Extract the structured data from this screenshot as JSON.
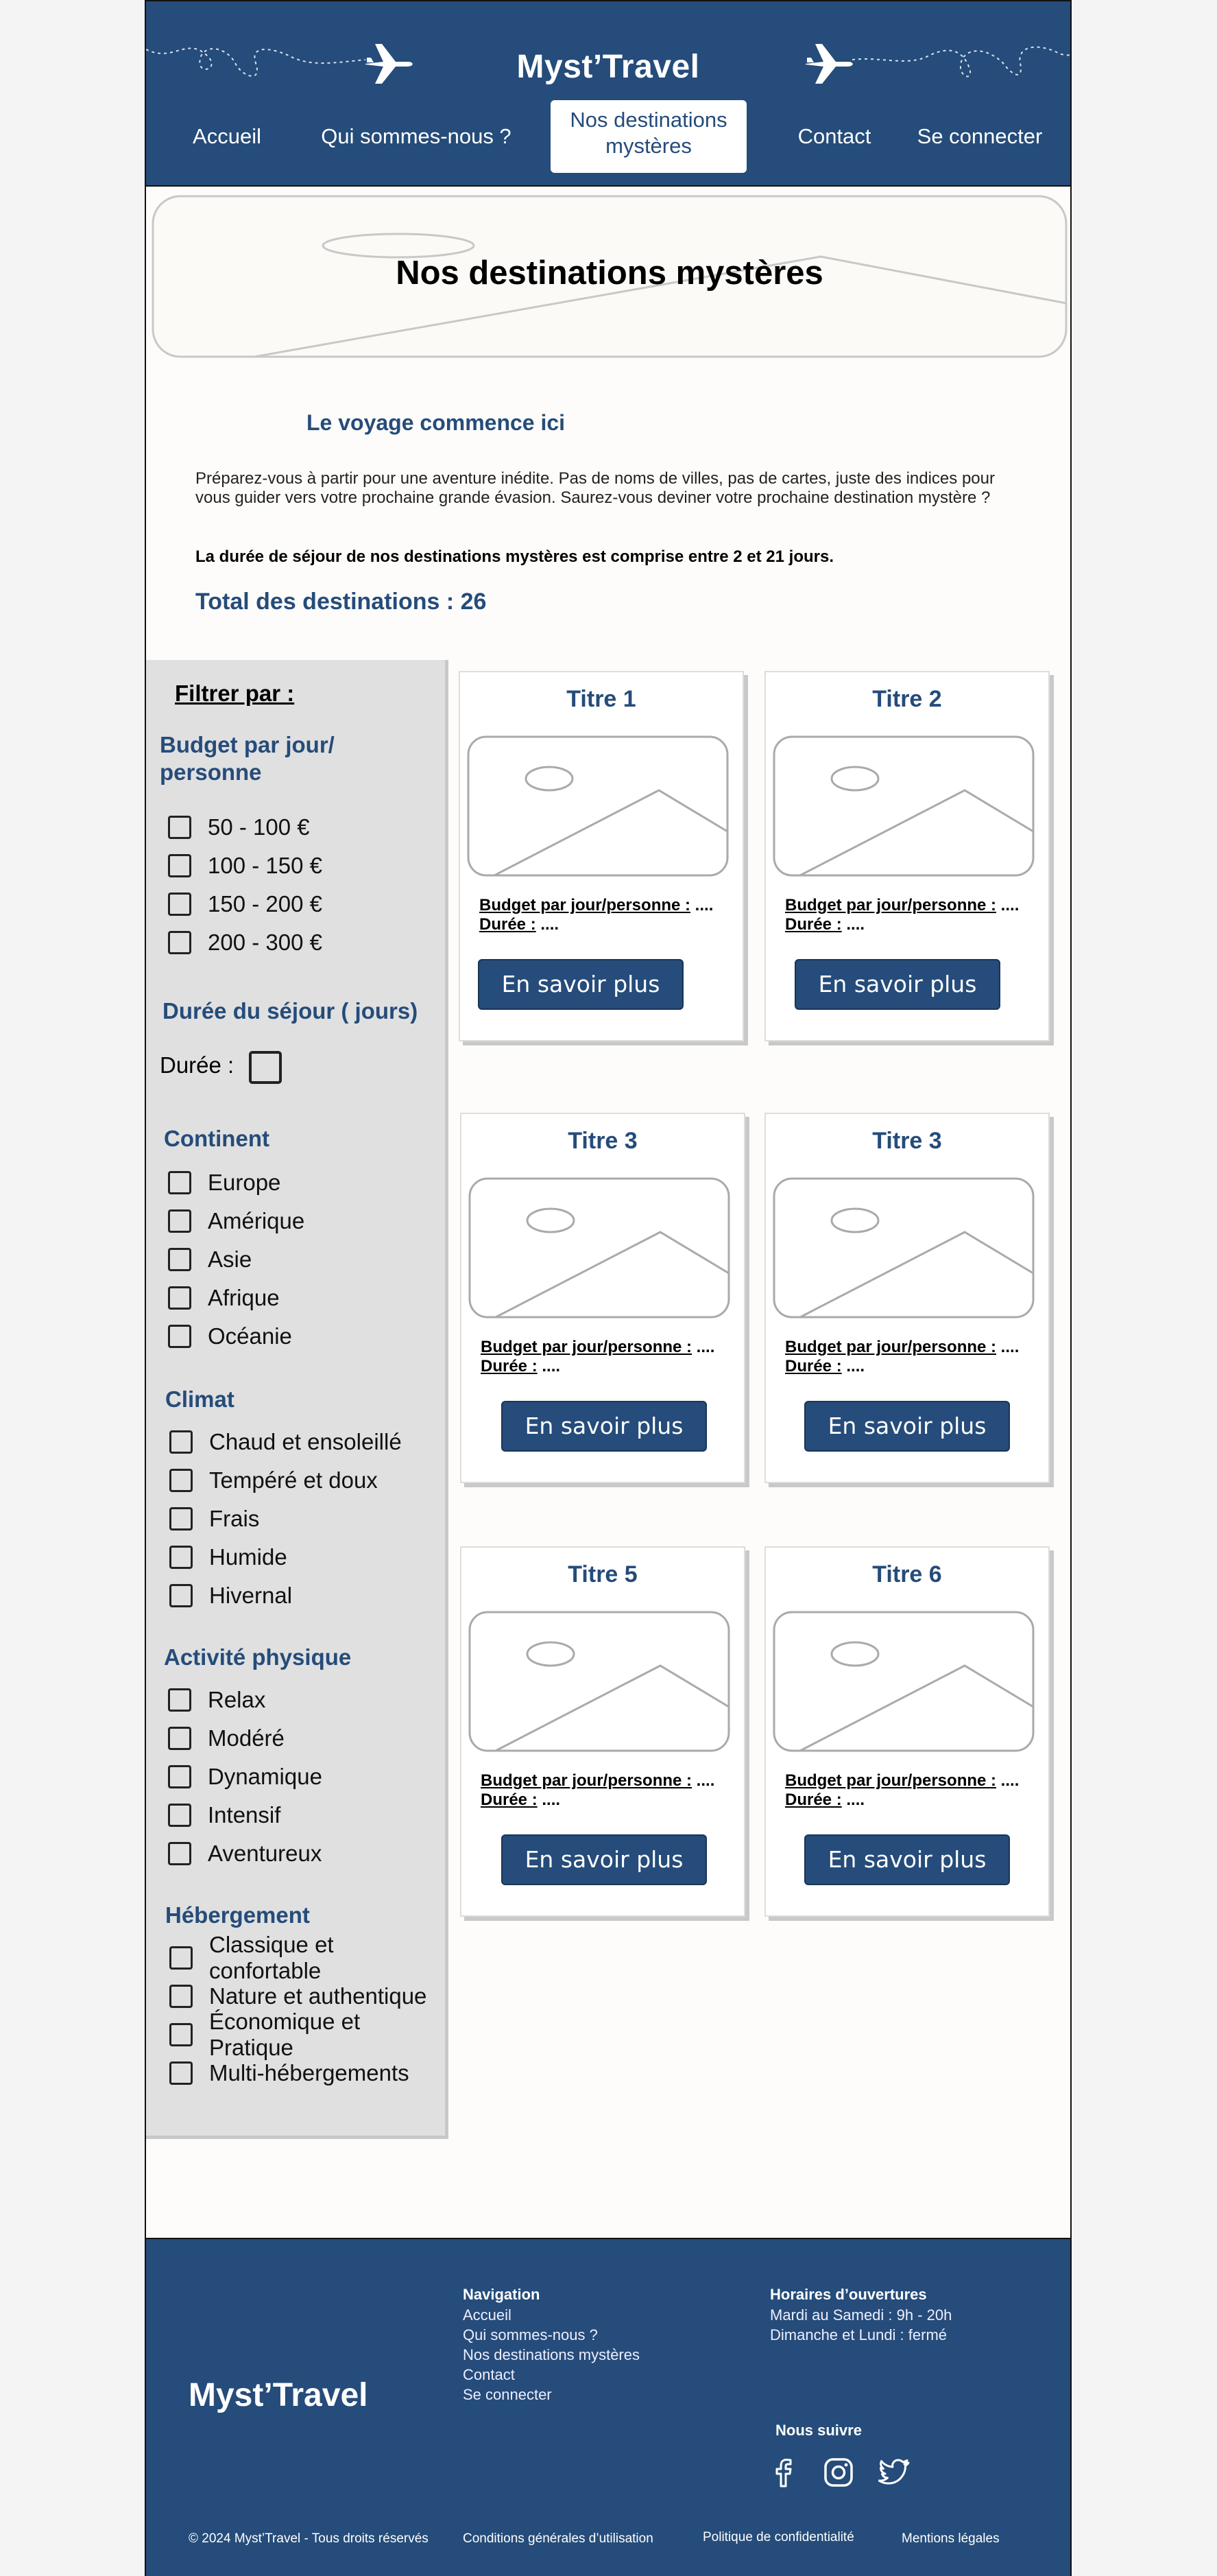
{
  "header": {
    "brand": "Myst’Travel",
    "nav": [
      {
        "label": "Accueil"
      },
      {
        "label": "Qui sommes-nous ?"
      },
      {
        "label": "Nos destinations mystères"
      },
      {
        "label": "Contact"
      },
      {
        "label": "Se connecter"
      }
    ]
  },
  "hero": {
    "title": "Nos destinations mystères"
  },
  "main": {
    "subtitle": "Le voyage commence ici",
    "intro": "Préparez-vous à partir pour une aventure inédite. Pas de noms de villes, pas de cartes, juste des indices pour vous guider vers votre prochaine grande évasion. Saurez-vous deviner votre prochaine destination mystère ?",
    "duration_note": "La durée de séjour de nos destinations mystères est comprise entre 2 et 21 jours.",
    "total": "Total des destinations : 26"
  },
  "filters": {
    "title": "Filtrer par :",
    "budget": {
      "title": "Budget par jour/ personne",
      "options": [
        "50 - 100 €",
        "100 - 150 €",
        "150 - 200 €",
        "200 - 300 €"
      ]
    },
    "duree": {
      "title": "Durée du séjour ( jours)",
      "label": "Durée :"
    },
    "continent": {
      "title": "Continent",
      "options": [
        "Europe",
        "Amérique",
        "Asie",
        "Afrique",
        "Océanie"
      ]
    },
    "climat": {
      "title": "Climat",
      "options": [
        "Chaud et ensoleillé",
        "Tempéré et doux",
        "Frais",
        "Humide",
        "Hivernal"
      ]
    },
    "activite": {
      "title": "Activité physique",
      "options": [
        "Relax",
        "Modéré",
        "Dynamique",
        "Intensif",
        "Aventureux"
      ]
    },
    "hebergement": {
      "title": "Hébergement",
      "options": [
        "Classique et confortable",
        "Nature et authentique",
        "Économique et Pratique",
        "Multi-hébergements"
      ]
    }
  },
  "cards": [
    {
      "title": "Titre 1"
    },
    {
      "title": "Titre 2"
    },
    {
      "title": "Titre 3"
    },
    {
      "title": "Titre 3"
    },
    {
      "title": "Titre 5"
    },
    {
      "title": "Titre 6"
    }
  ],
  "card_common": {
    "budget_label": "Budget par jour/personne :",
    "budget_value": " ....",
    "duree_label": "Durée :",
    "duree_value": " ....",
    "button": "En savoir plus"
  },
  "footer": {
    "brand": "Myst’Travel",
    "navigation_title": "Navigation",
    "navigation_links": [
      "Accueil",
      "Qui sommes-nous ?",
      "Nos destinations mystères",
      "Contact",
      "Se connecter"
    ],
    "hours_title": "Horaires d’ouvertures",
    "hours": [
      "Mardi au Samedi : 9h - 20h",
      "Dimanche et Lundi : fermé"
    ],
    "follow_title": "Nous suivre",
    "social_icons": [
      "facebook-icon",
      "instagram-icon",
      "twitter-icon"
    ],
    "copyright": "© 2024 Myst’Travel - Tous droits réservés",
    "cgu": "Conditions générales d’utilisation",
    "privacy": "Politique de confidentialité",
    "legal": "Mentions légales"
  },
  "colors": {
    "primary": "#254c7a",
    "sidebar_bg": "#e0e0e0",
    "page_bg": "#fdfcfa"
  }
}
